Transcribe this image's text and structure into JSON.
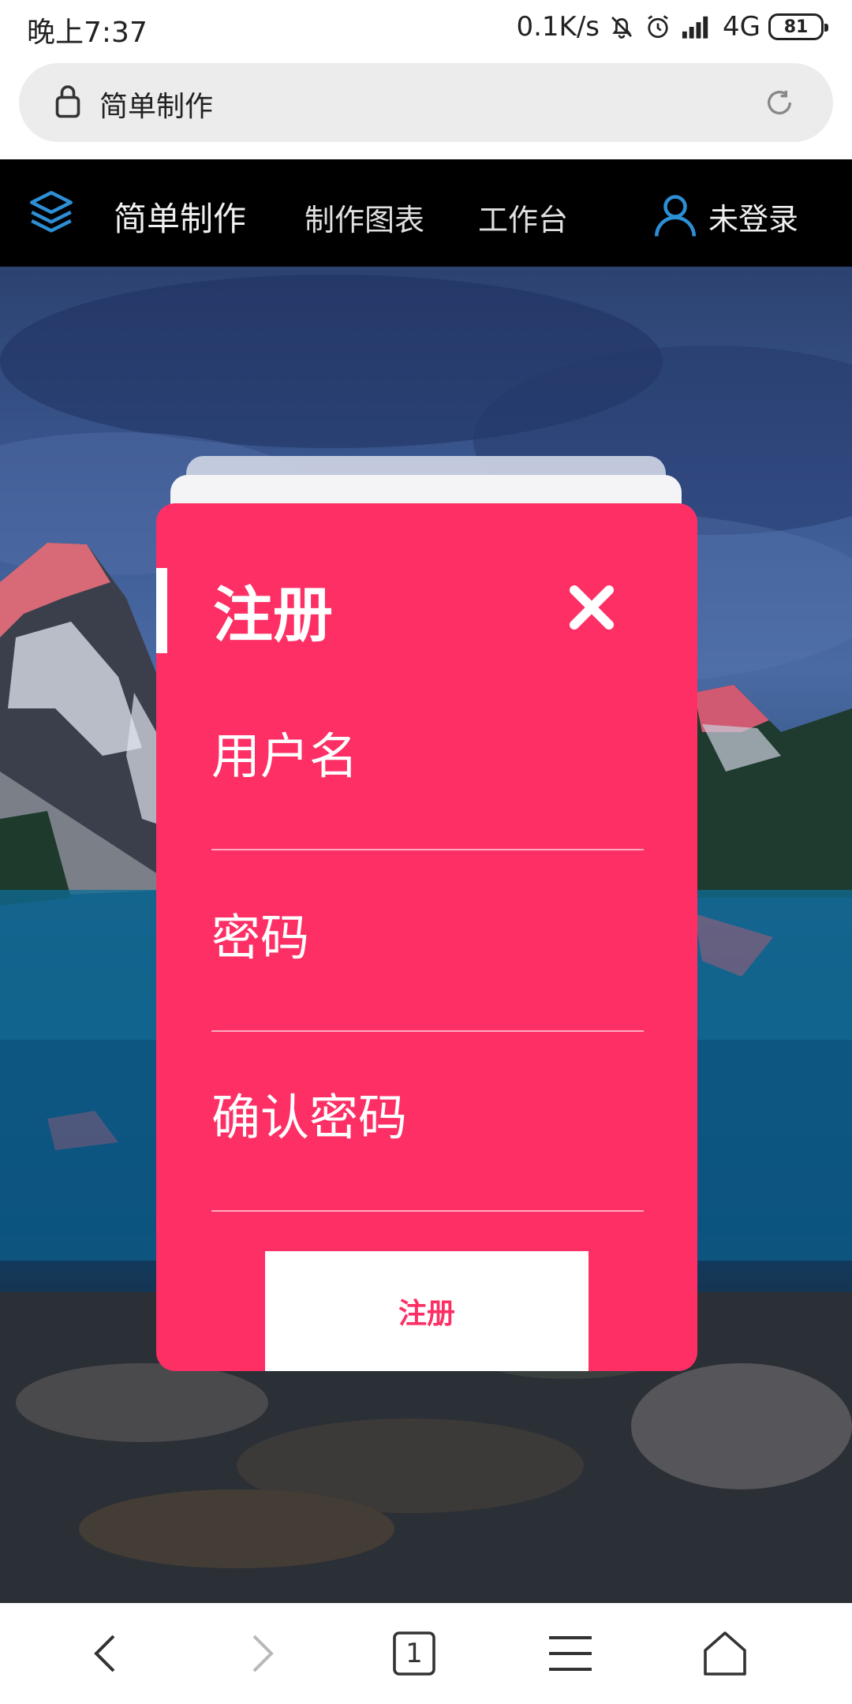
{
  "status_bar": {
    "time": "晚上7:37",
    "net_speed": "0.1K/s",
    "signal_label": "4G",
    "battery": "81"
  },
  "url_bar": {
    "title": "简单制作"
  },
  "nav": {
    "brand": "简单制作",
    "links": [
      "制作图表",
      "工作台"
    ],
    "user_label": "未登录",
    "accent_color": "#2d8fd6"
  },
  "register_modal": {
    "title": "注册",
    "fields": [
      {
        "label": "用户名"
      },
      {
        "label": "密码"
      },
      {
        "label": "确认密码"
      }
    ],
    "submit_label": "注册",
    "card_color": "#fd2f65"
  },
  "bottom_bar": {
    "tab_count": "1",
    "icons": [
      "back-icon",
      "forward-icon",
      "tabs-icon",
      "menu-icon",
      "home-icon"
    ]
  }
}
